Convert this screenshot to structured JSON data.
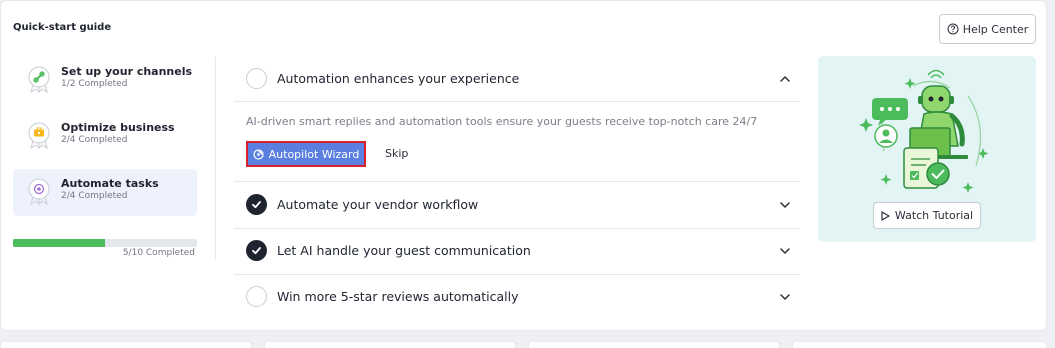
{
  "header": {
    "title": "Quick-start guide",
    "help_label": "Help Center"
  },
  "steps": [
    {
      "title": "Set up your channels",
      "subtitle": "1/2 Completed",
      "active": false,
      "icon": "link-icon"
    },
    {
      "title": "Optimize business",
      "subtitle": "2/4 Completed",
      "active": false,
      "icon": "business-icon"
    },
    {
      "title": "Automate tasks",
      "subtitle": "2/4 Completed",
      "active": true,
      "icon": "automation-icon"
    }
  ],
  "progress": {
    "label": "5/10 Completed",
    "fraction": 0.5
  },
  "accordion": [
    {
      "title": "Automation enhances your experience",
      "completed": false,
      "expanded": true,
      "description": "AI-driven smart replies and automation tools ensure your guests receive top-notch care 24/7",
      "primary_label": "Autopilot Wizard",
      "secondary_label": "Skip"
    },
    {
      "title": "Automate your vendor workflow",
      "completed": true,
      "expanded": false
    },
    {
      "title": "Let AI handle your guest communication",
      "completed": true,
      "expanded": false
    },
    {
      "title": "Win more 5-star reviews automatically",
      "completed": false,
      "expanded": false
    }
  ],
  "tutorial": {
    "label": "Watch Tutorial"
  },
  "colors": {
    "accent": "#5b7fe0",
    "progress": "#4cbb5c",
    "highlight_border": "#d9202a",
    "illustration_bg": "#e3f4f4"
  }
}
